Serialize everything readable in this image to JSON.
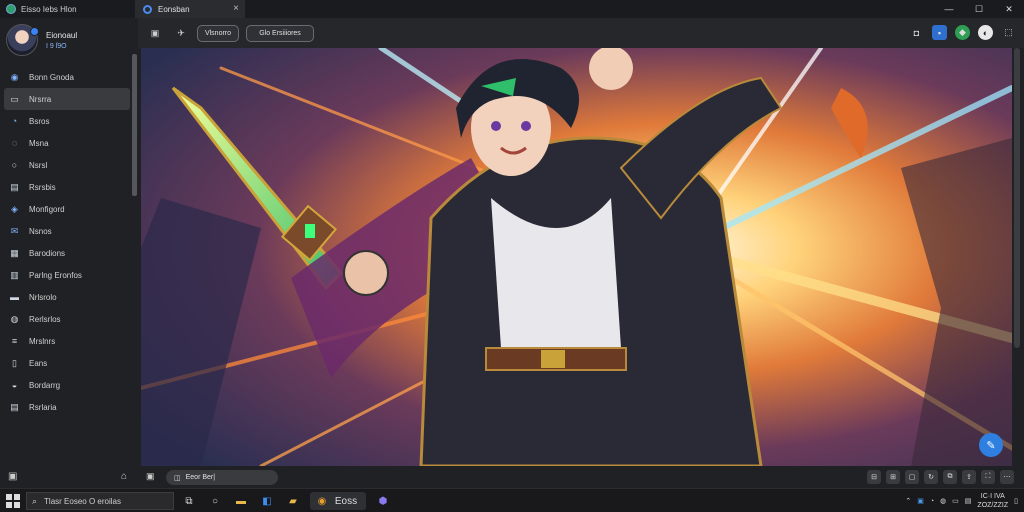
{
  "window": {
    "app_title": "Eisso Iebs Hlon",
    "tab_title": "Eonsban",
    "tab_close": "×",
    "minimize": "—",
    "maximize": "☐",
    "close": "✕"
  },
  "profile": {
    "name": "Eionoaul",
    "sub": "I 9 ſ9O"
  },
  "sidebar": {
    "items": [
      {
        "label": "Bonn Gnoda",
        "icon": "globe-icon"
      },
      {
        "label": "Nrsrra",
        "icon": "folder-icon",
        "active": true
      },
      {
        "label": "Bsros",
        "icon": "chat-icon"
      },
      {
        "label": "Msna",
        "icon": "chat-bubble-icon"
      },
      {
        "label": "Nsrsl",
        "icon": "circle-icon"
      },
      {
        "label": "Rsrsbis",
        "icon": "document-icon"
      },
      {
        "label": "Monfigord",
        "icon": "people-icon"
      },
      {
        "label": "Nsnos",
        "icon": "mail-icon"
      },
      {
        "label": "Barodions",
        "icon": "news-icon"
      },
      {
        "label": "Parlng Eronfos",
        "icon": "chart-icon"
      },
      {
        "label": "Nrlsrolo",
        "icon": "monitor-icon"
      },
      {
        "label": "Rerlsrlos",
        "icon": "tag-icon"
      },
      {
        "label": "Mrslnrs",
        "icon": "list-icon"
      },
      {
        "label": "Eans",
        "icon": "bookmark-icon"
      },
      {
        "label": "Bordarrg",
        "icon": "cloud-icon"
      },
      {
        "label": "Rsrlaria",
        "icon": "page-icon"
      }
    ]
  },
  "toolbar": {
    "pill_one": "Vlsnorro",
    "pill_two": "Glo Ersiiiores"
  },
  "statusbar": {
    "field": "Eeor Ber|"
  },
  "taskbar": {
    "search_placeholder": "Tlasr Eoseo O eroilas",
    "active_app": "Eoss",
    "clock_time": "IC·I IVA",
    "clock_date": "ZOZ/ZZIZ"
  },
  "colors": {
    "accent": "#2f7fe0",
    "sidebar_bg": "#202124",
    "active_item": "#3a3b3f"
  }
}
